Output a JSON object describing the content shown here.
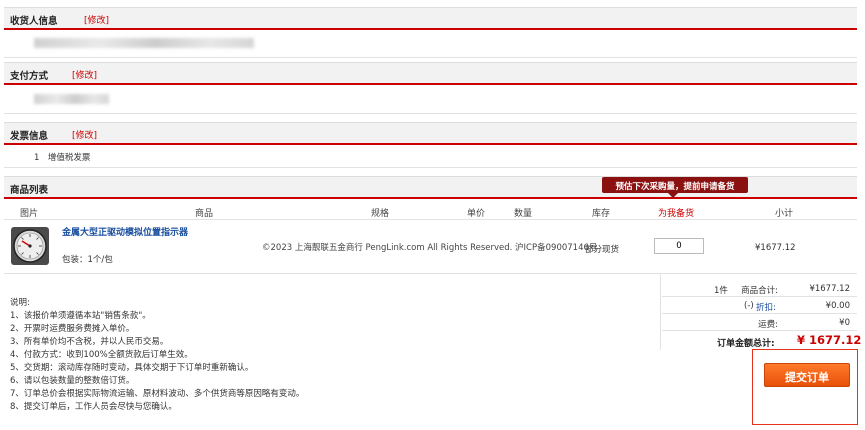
{
  "sections": {
    "receiver": {
      "title": "收货人信息",
      "edit": "[修改]"
    },
    "payment": {
      "title": "支付方式",
      "edit": "[修改]"
    },
    "invoice": {
      "title": "发票信息",
      "edit": "[修改]",
      "value": "1　增值税发票"
    },
    "goods": {
      "title": "商品列表"
    }
  },
  "tooltip": "预估下次采购量，提前申请备货",
  "columns": [
    "图片",
    "商品",
    "规格",
    "单价",
    "数量",
    "库存",
    "为我备货",
    "小计"
  ],
  "product": {
    "name": "金属大型正驱动模拟位置指示器",
    "package": "包装：1个/包",
    "stock": "部分现货",
    "reserve_qty": "0",
    "subtotal": "¥1677.12"
  },
  "copyright": "©2023 上海靓联五金商行 PengLink.com All Rights Reserved. 沪ICP备09007146号",
  "summary": {
    "count": "1件",
    "goods_total_label": "商品合计:",
    "goods_total": "¥1677.12",
    "discount_prefix": "(-)",
    "discount_label": "折扣:",
    "discount": "¥0.00",
    "shipping_label": "运费:",
    "shipping": "¥0",
    "order_total_label": "订单金额总计:",
    "order_total": "¥ 1677.12"
  },
  "notes": [
    "说明:",
    "1、该报价单须遵循本站\"销售条款\"。",
    "2、开票时运费服务费摊入单价。",
    "3、所有单价均不含税，并以人民币交易。",
    "4、付款方式：收到100%全额货款后订单生效。",
    "5、交货期：滚动库存随时变动，具体交期于下订单时重新确认。",
    "6、请以包装数量的整数倍订货。",
    "7、订单总价会根据实际物流运输、原材料波动、多个供货商等原因略有变动。",
    "8、提交订单后，工作人员会尽快与您确认。"
  ],
  "submit_label": "提交订单",
  "colors": {
    "accent": "#cc0000",
    "button": "#f25c0e",
    "tooltip_bg": "#8b1010",
    "link": "#1a4fa0"
  }
}
